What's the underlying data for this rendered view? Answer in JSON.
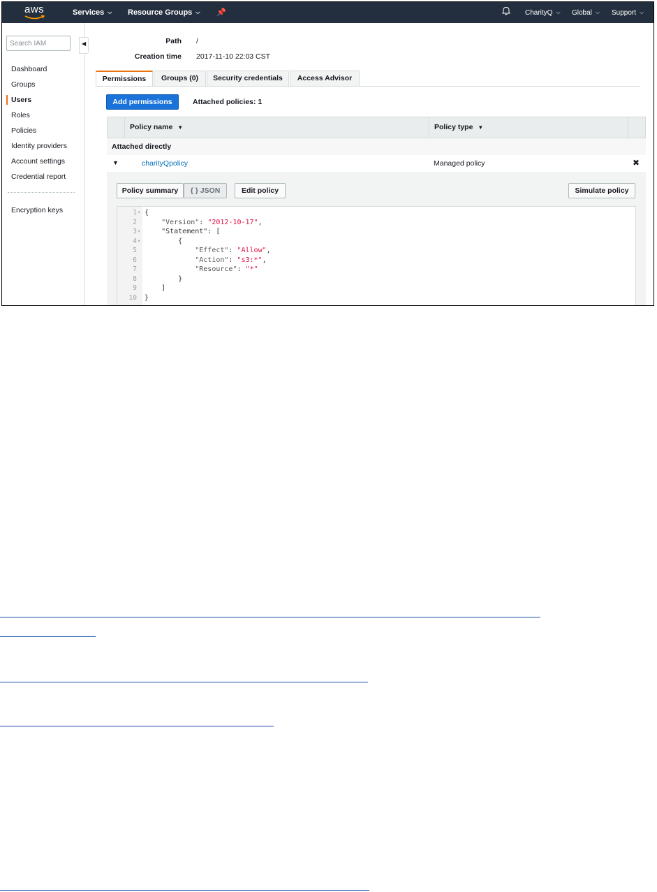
{
  "nav": {
    "logo": "aws",
    "services": "Services",
    "resource_groups": "Resource Groups",
    "pin_icon": "pin-icon",
    "bell_icon": "bell-icon",
    "account": "CharityQ",
    "region": "Global",
    "support": "Support"
  },
  "sidebar": {
    "search_placeholder": "Search IAM",
    "items": [
      {
        "label": "Dashboard"
      },
      {
        "label": "Groups"
      },
      {
        "label": "Users"
      },
      {
        "label": "Roles"
      },
      {
        "label": "Policies"
      },
      {
        "label": "Identity providers"
      },
      {
        "label": "Account settings"
      },
      {
        "label": "Credential report"
      }
    ],
    "active_item": "Users",
    "secondary": "Encryption keys"
  },
  "summary": {
    "path_label": "Path",
    "path_value": "/",
    "creation_label": "Creation time",
    "creation_value": "2017-11-10 22:03 CST"
  },
  "tabs": [
    {
      "label": "Permissions"
    },
    {
      "label": "Groups (0)"
    },
    {
      "label": "Security credentials"
    },
    {
      "label": "Access Advisor"
    }
  ],
  "active_tab": "Permissions",
  "permissions": {
    "add_button": "Add permissions",
    "attached_count": "Attached policies: 1",
    "columns": [
      "Policy name",
      "Policy type"
    ],
    "group_label": "Attached directly",
    "policy": {
      "name": "charityQpolicy",
      "type": "Managed policy"
    },
    "detail_buttons": {
      "summary": "Policy summary",
      "json": "{ } JSON",
      "edit": "Edit policy",
      "simulate": "Simulate policy"
    },
    "json_lines": [
      "{",
      "    \"Version\": \"2012-10-17\",",
      "    \"Statement\": [",
      "        {",
      "            \"Effect\": \"Allow\",",
      "            \"Action\": \"s3:*\",",
      "            \"Resource\": \"*\"",
      "        }",
      "    ]",
      "}"
    ]
  },
  "colors": {
    "nav_bg": "#232f3e",
    "accent": "#ec7211",
    "primary_button": "#1a73d9",
    "link": "#0073bb",
    "json_string": "#d14"
  }
}
